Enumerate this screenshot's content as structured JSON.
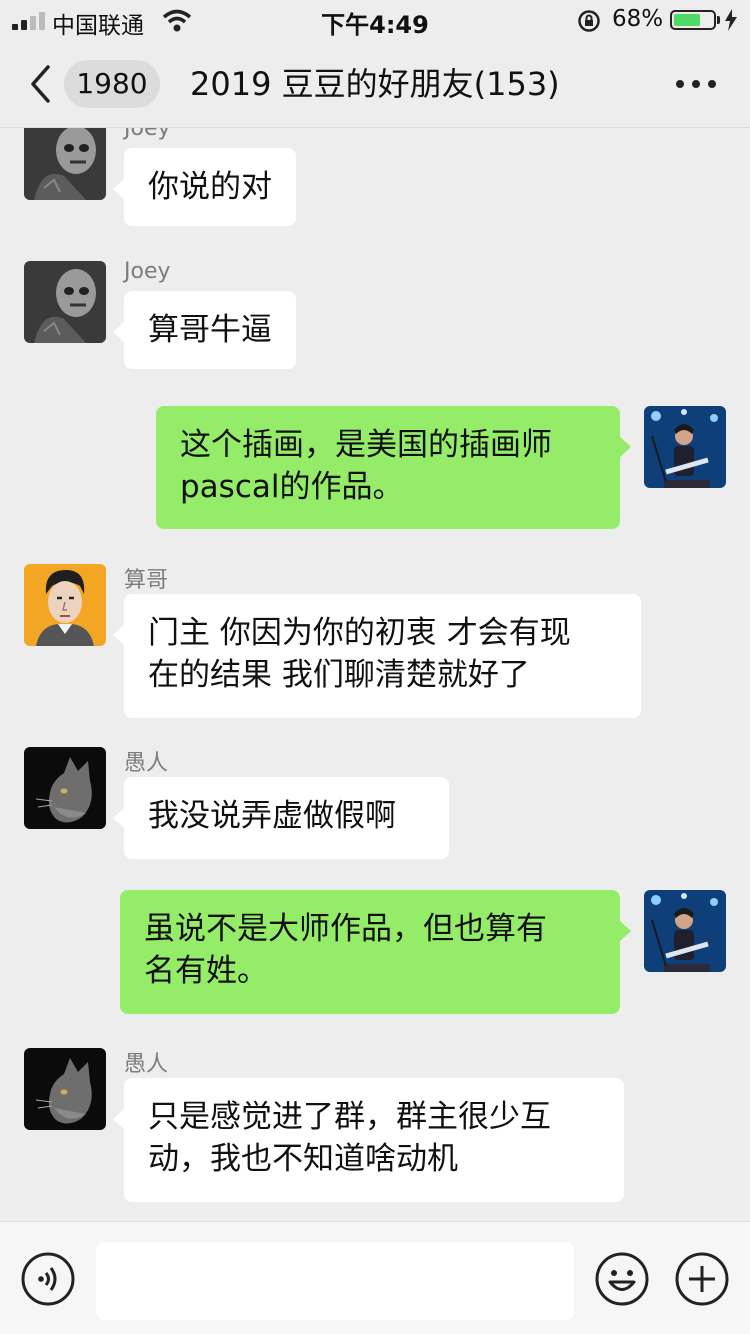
{
  "status_bar": {
    "carrier": "中国联通",
    "time": "下午4:49",
    "battery_percent": "68%",
    "battery_level": 0.68,
    "signal_bars": 2
  },
  "nav": {
    "unread_count": "1980",
    "title": "2019 豆豆的好朋友(153)"
  },
  "colors": {
    "outgoing_bubble": "#95ec69",
    "incoming_bubble": "#ffffff",
    "background": "#ededed"
  },
  "messages": [
    {
      "direction": "in",
      "sender": "Joey",
      "avatar": "skull-face-avatar",
      "lines": [
        "你说的对"
      ]
    },
    {
      "direction": "in",
      "sender": "Joey",
      "avatar": "skull-face-avatar",
      "lines": [
        "算哥牛逼"
      ]
    },
    {
      "direction": "out",
      "avatar": "guitarist-avatar",
      "lines": [
        "这个插画，是美国的插画师",
        "pascal的作品。"
      ]
    },
    {
      "direction": "in",
      "sender": "算哥",
      "avatar": "illustrated-man-avatar",
      "lines": [
        "门主 你因为你的初衷 才会有现",
        "在的结果 我们聊清楚就好了"
      ]
    },
    {
      "direction": "in",
      "sender": "愚人",
      "avatar": "cat-avatar",
      "lines": [
        "我没说弄虚做假啊"
      ]
    },
    {
      "direction": "out",
      "avatar": "guitarist-avatar",
      "lines": [
        "虽说不是大师作品，但也算有",
        "名有姓。"
      ]
    },
    {
      "direction": "in",
      "sender": "愚人",
      "avatar": "cat-avatar",
      "lines": [
        "只是感觉进了群，群主很少互",
        "动，我也不知道啥动机"
      ]
    }
  ],
  "input": {
    "voice_icon": "voice-icon",
    "emoji_icon": "emoji-icon",
    "more_icon": "plus-icon"
  }
}
